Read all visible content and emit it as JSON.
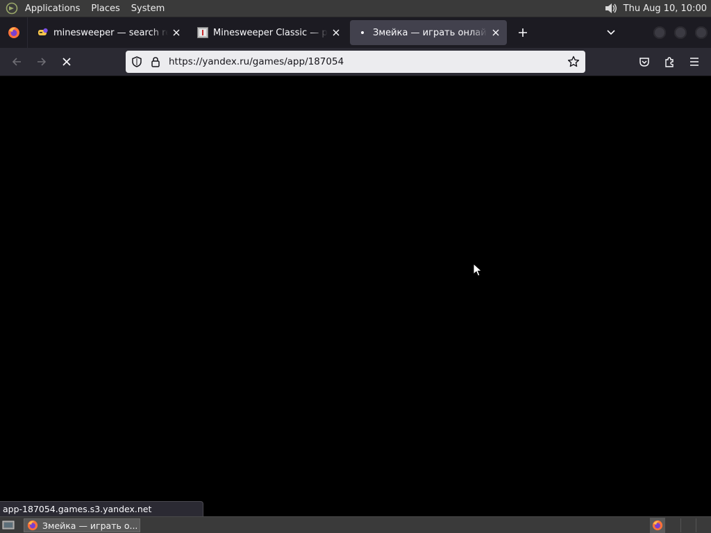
{
  "top_panel": {
    "menus": [
      "Applications",
      "Places",
      "System"
    ],
    "clock": "Thu Aug 10, 10:00",
    "icons": [
      "gnome-foot-icon",
      "volume-icon"
    ]
  },
  "browser": {
    "tabs": [
      {
        "title": "minesweeper — search results",
        "favicon": "yandex-games-icon",
        "active": false
      },
      {
        "title": "Minesweeper Classic — play online",
        "favicon": "minesweeper-icon",
        "active": false
      },
      {
        "title": "Змейка — играть онлайн бесплатно",
        "favicon": "loading-dot",
        "active": true
      }
    ],
    "url": "https://yandex.ru/games/app/187054",
    "status_text": "app-187054.games.s3.yandex.net",
    "loading": true
  },
  "taskbar": {
    "window_label": "Змейка — играть о...",
    "icons": [
      "show-desktop-icon",
      "firefox-icon"
    ]
  },
  "colors": {
    "panel": "#3a3a3a",
    "tabstrip": "#1c1b22",
    "toolbar": "#2b2a33",
    "active_tab": "#42414d",
    "urlbar": "#ececef",
    "content": "#000000"
  }
}
